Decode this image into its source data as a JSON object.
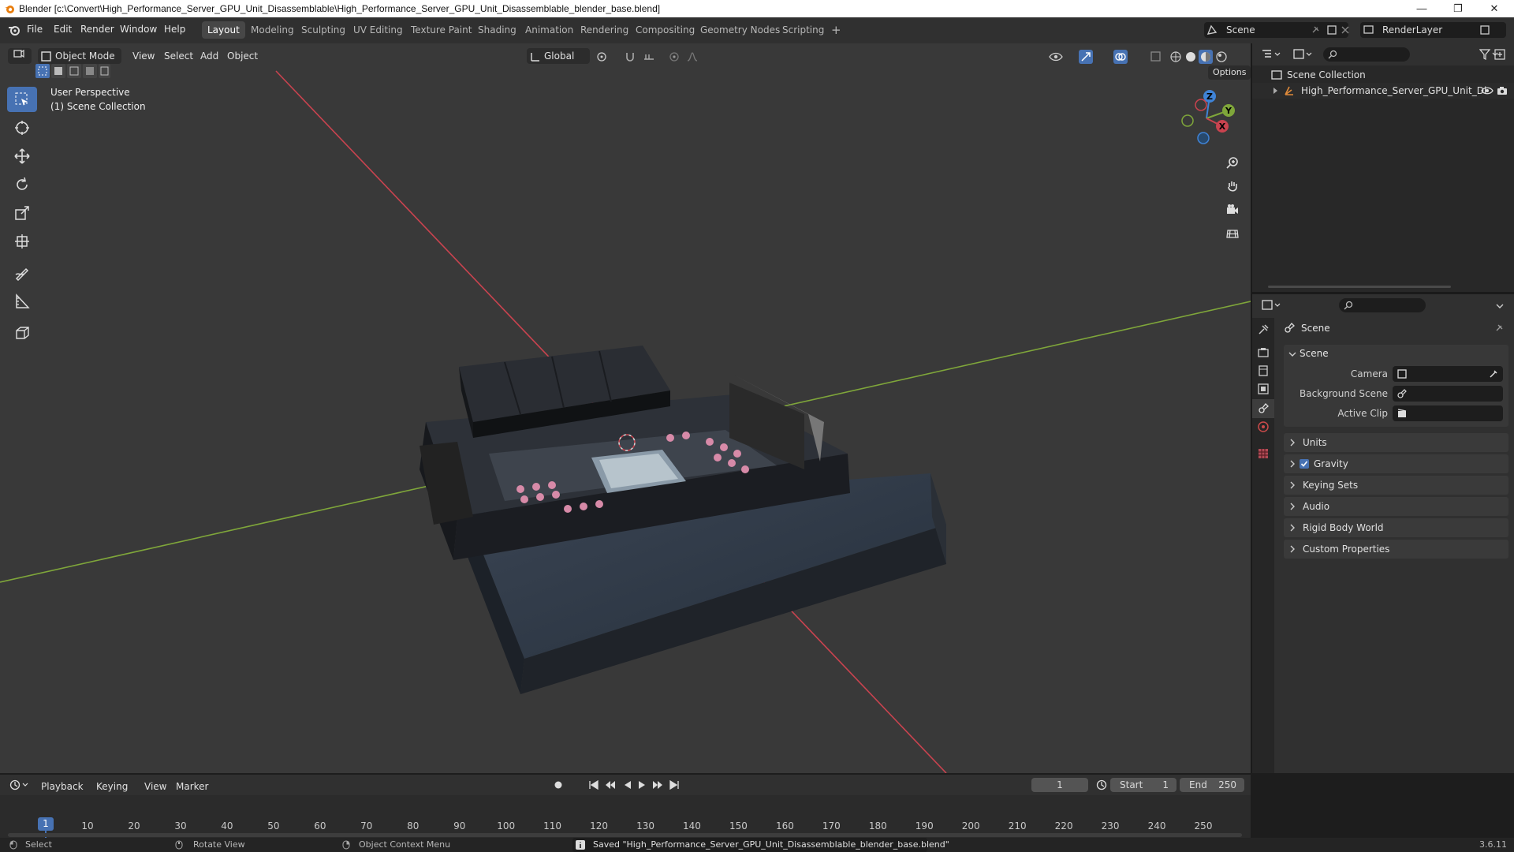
{
  "window": {
    "title": "Blender [c:\\Convert\\High_Performance_Server_GPU_Unit_Disassemblable\\High_Performance_Server_GPU_Unit_Disassemblable_blender_base.blend]",
    "minimize": "—",
    "maximize": "❐",
    "close": "✕"
  },
  "menu": {
    "file": "File",
    "edit": "Edit",
    "render": "Render",
    "window": "Window",
    "help": "Help"
  },
  "workspaces": [
    "Layout",
    "Modeling",
    "Sculpting",
    "UV Editing",
    "Texture Paint",
    "Shading",
    "Animation",
    "Rendering",
    "Compositing",
    "Geometry Nodes",
    "Scripting"
  ],
  "active_workspace": "Layout",
  "add_workspace": "+",
  "scene_selector": {
    "value": "Scene"
  },
  "view_layer_selector": {
    "value": "RenderLayer"
  },
  "viewport": {
    "mode": "Object Mode",
    "menus": {
      "view": "View",
      "select": "Select",
      "add": "Add",
      "object": "Object"
    },
    "orientation": "Global",
    "options": "Options",
    "overlay_title": "User Perspective",
    "overlay_collection": "(1) Scene Collection",
    "gizmo": {
      "x": "X",
      "y": "Y",
      "z": "Z"
    },
    "colors": {
      "x_axis": "#c9434f",
      "y_axis": "#7fa63a",
      "z_axis": "#3f83d6",
      "active": "#4772b3"
    }
  },
  "outliner": {
    "root": "Scene Collection",
    "items": [
      {
        "label": "High_Performance_Server_GPU_Unit_Di"
      }
    ]
  },
  "properties": {
    "header": "Scene",
    "scene_panel": {
      "title": "Scene",
      "camera_label": "Camera",
      "background_scene_label": "Background Scene",
      "active_clip_label": "Active Clip"
    },
    "panels": [
      "Units",
      "Gravity",
      "Keying Sets",
      "Audio",
      "Rigid Body World",
      "Custom Properties"
    ],
    "gravity_checked": true
  },
  "timeline": {
    "menus": {
      "playback": "Playback",
      "keying": "Keying",
      "view": "View",
      "marker": "Marker"
    },
    "current_frame": "1",
    "start_label": "Start",
    "start": "1",
    "end_label": "End",
    "end": "250",
    "ticks": [
      "1",
      "10",
      "20",
      "30",
      "40",
      "50",
      "60",
      "70",
      "80",
      "90",
      "100",
      "110",
      "120",
      "130",
      "140",
      "150",
      "160",
      "170",
      "180",
      "190",
      "200",
      "210",
      "220",
      "230",
      "240",
      "250"
    ]
  },
  "statusbar": {
    "select": "Select",
    "rotate": "Rotate View",
    "context": "Object Context Menu",
    "message": "Saved \"High_Performance_Server_GPU_Unit_Disassemblable_blender_base.blend\"",
    "version": "3.6.11"
  }
}
